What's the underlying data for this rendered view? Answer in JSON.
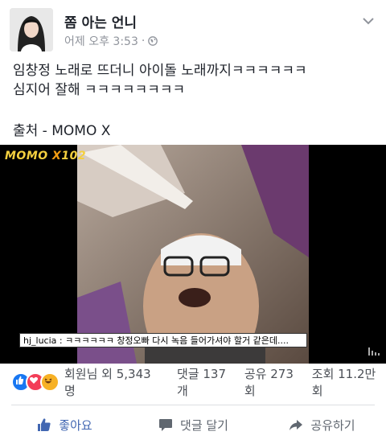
{
  "post": {
    "page_name": "쫌 아는 언니",
    "timestamp": "어제 오후 3:53",
    "separator": "·",
    "text_lines": [
      "임창정 노래로 뜨더니 아이돌 노래까지ㅋㅋㅋㅋㅋㅋ",
      "심지어 잘해 ㅋㅋㅋㅋㅋㅋㅋㅋ"
    ],
    "source": "출처 - MOMO X"
  },
  "video": {
    "logo_main": "MOMO",
    "logo_x": "X",
    "logo_num": "102",
    "caption": "hj_lucia : ㅋㅋㅋㅋㅋㅋ 창정오빠 다시 녹음 들어가셔야 할거 같은데...."
  },
  "reactions": {
    "summary": "회원님 외 5,343명",
    "comments": "댓글 137개",
    "shares": "공유 273회",
    "views": "조회 11.2만회",
    "colors": {
      "like": "#1877f2",
      "love": "#f33e58",
      "haha": "#f7b125"
    }
  },
  "actions": {
    "like_label": "좋아요",
    "comment_label": "댓글 달기",
    "share_label": "공유하기",
    "like_color": "#4267b2"
  }
}
